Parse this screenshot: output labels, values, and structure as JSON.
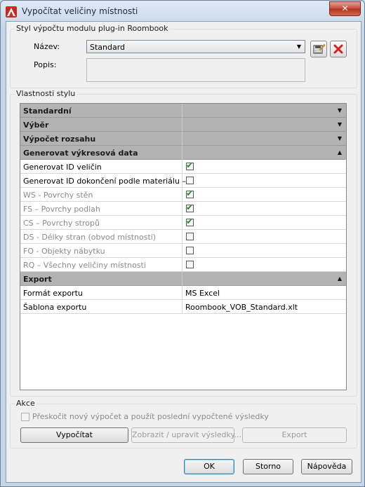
{
  "window": {
    "title": "Vypočítat veličiny místnosti",
    "close_glyph": "✕"
  },
  "style_group": {
    "label": "Styl výpočtu modulu plug-in Roombook",
    "name_label": "Název:",
    "name_value": "Standard",
    "desc_label": "Popis:",
    "desc_value": ""
  },
  "properties_group": {
    "label": "Vlastnosti stylu",
    "rows": [
      {
        "type": "category",
        "name": "Standardní",
        "expanded": false
      },
      {
        "type": "category",
        "name": "Výběr",
        "expanded": false
      },
      {
        "type": "category",
        "name": "Výpočet rozsahu",
        "expanded": false
      },
      {
        "type": "category",
        "name": "Generovat výkresová data",
        "expanded": true
      },
      {
        "type": "check",
        "name": "Generovat ID veličin",
        "checked": true,
        "disabled": false
      },
      {
        "type": "check",
        "name": "Generovat ID dokončení podle materiálu –",
        "checked": false,
        "disabled": false
      },
      {
        "type": "check",
        "name": "WS - Povrchy stěn",
        "checked": true,
        "disabled": true
      },
      {
        "type": "check",
        "name": "FS – Povrchy podlah",
        "checked": true,
        "disabled": true
      },
      {
        "type": "check",
        "name": "CS – Povrchy stropů",
        "checked": true,
        "disabled": true
      },
      {
        "type": "check",
        "name": "DS - Délky stran (obvod místnosti)",
        "checked": false,
        "disabled": true
      },
      {
        "type": "check",
        "name": "FO - Objekty nábytku",
        "checked": false,
        "disabled": true
      },
      {
        "type": "check",
        "name": "RQ – Všechny veličiny místnosti",
        "checked": false,
        "disabled": true
      },
      {
        "type": "category",
        "name": "Export",
        "expanded": true
      },
      {
        "type": "text",
        "name": "Formát exportu",
        "value": "MS Excel"
      },
      {
        "type": "text",
        "name": "Šablona exportu",
        "value": "Roombook_VOB_Standard.xlt"
      }
    ]
  },
  "actions_group": {
    "label": "Akce",
    "skip_label": "Přeskočit nový výpočet a použít poslední vypočtené výsledky",
    "calc_button": "Vypočítat",
    "show_button": "Zobrazit / upravit výsledky...",
    "export_button": "Export"
  },
  "footer": {
    "ok": "OK",
    "cancel": "Storno",
    "help": "Nápověda"
  }
}
